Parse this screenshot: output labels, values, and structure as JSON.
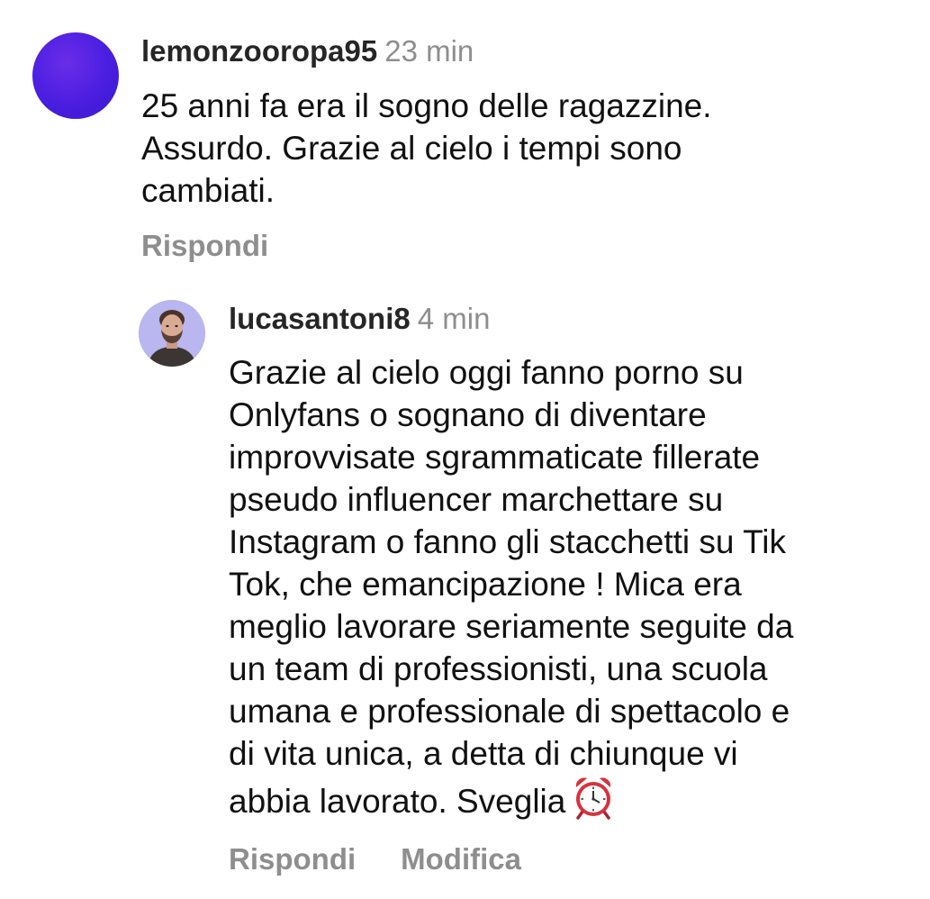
{
  "top_comment": {
    "username": "lemonzooropa95",
    "time": "23 min",
    "text": "25 anni fa era il sogno delle ragazzine.\nAssurdo. Grazie al cielo i tempi sono\ncambiati.",
    "reply_label": "Rispondi",
    "avatar_color": "#4a1ee0"
  },
  "reply_comment": {
    "username": "lucasantoni8",
    "time": "4 min",
    "text": "Grazie al cielo oggi fanno porno su\nOnlyfans o sognano di diventare\nimprovvisate sgrammaticate fillerate\npseudo influencer marchettare su\nInstagram o fanno gli stacchetti su Tik\nTok, che emancipazione ! Mica era\nmeglio lavorare seriamente seguite da\nun team di professionisti, una scuola\numana e professionale di spettacolo e\ndi vita unica, a detta di chiunque vi\nabbia lavorato. Sveglia",
    "emoji": "alarm-clock-icon",
    "reply_label": "Rispondi",
    "edit_label": "Modifica",
    "avatar_bg": "#b9b6f0"
  }
}
